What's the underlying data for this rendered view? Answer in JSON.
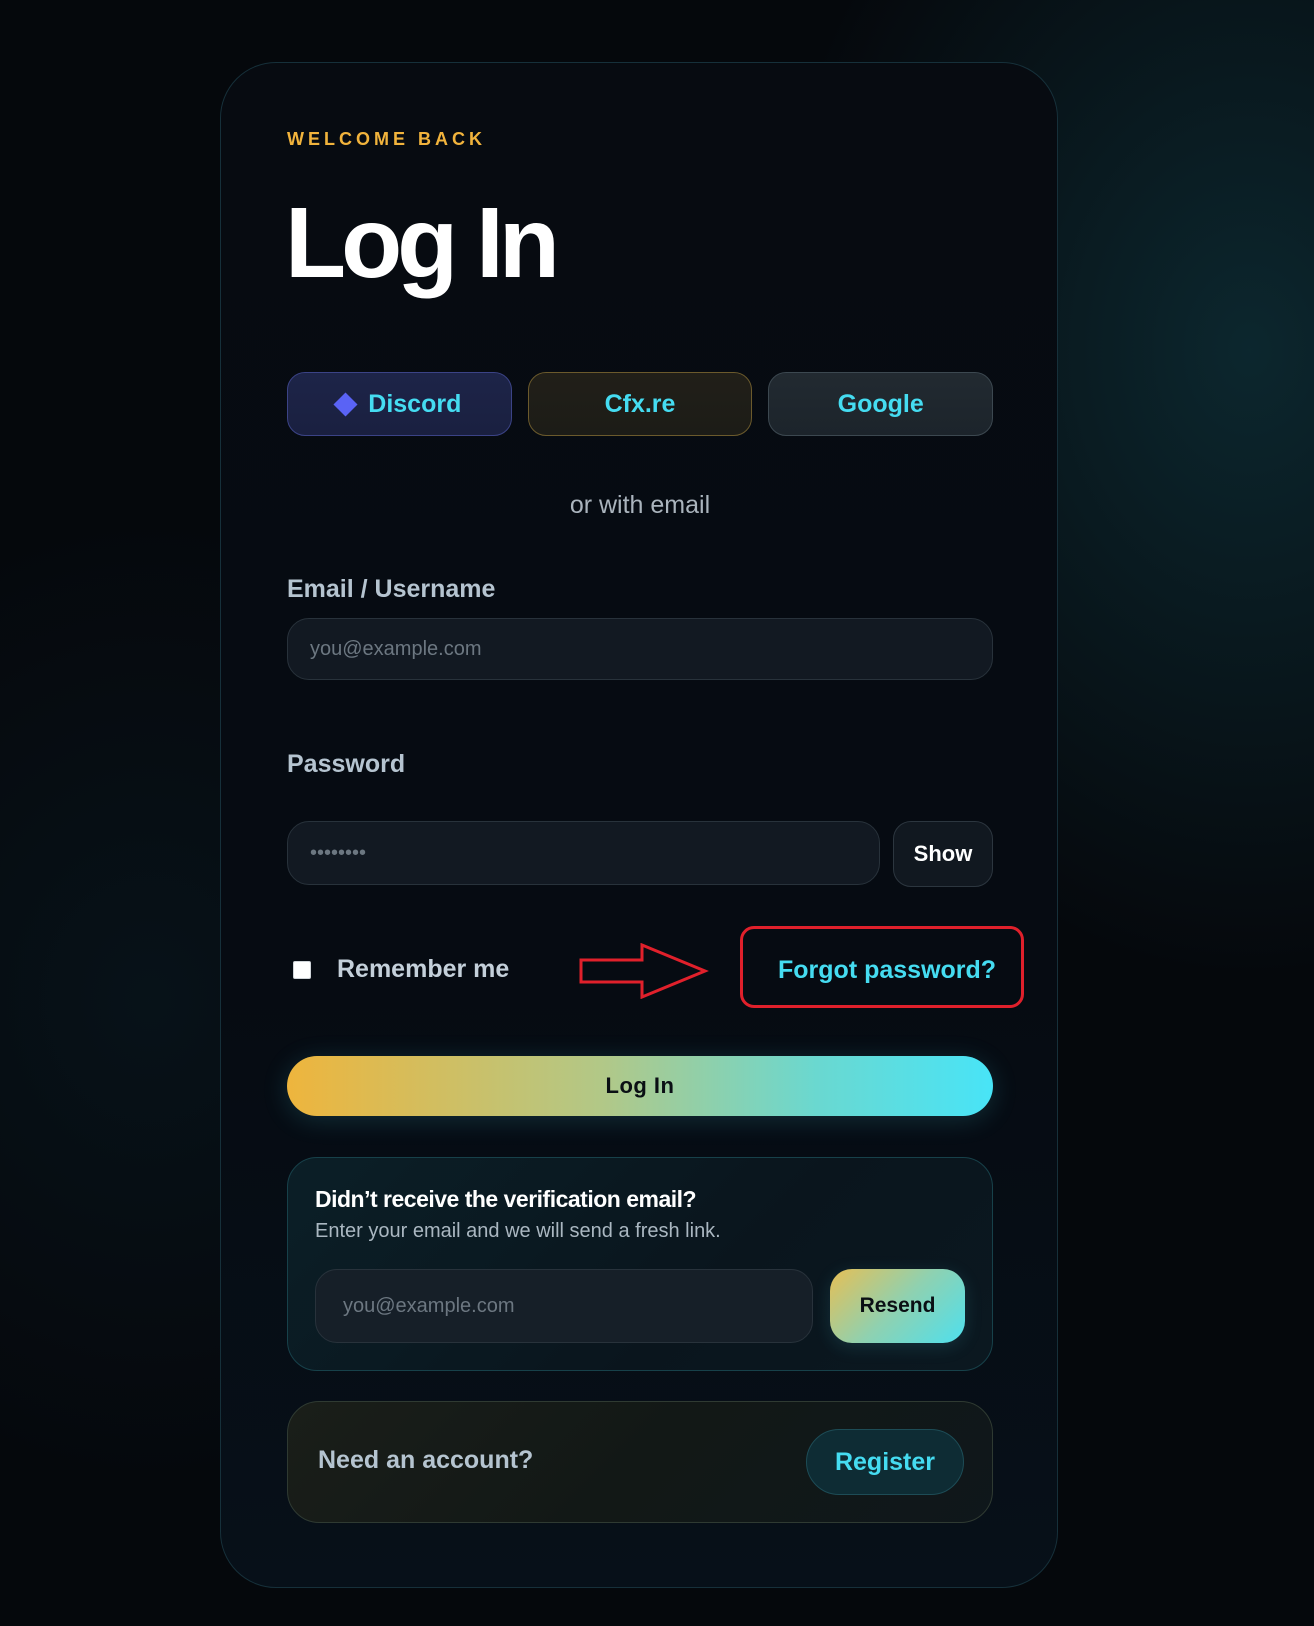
{
  "header": {
    "eyebrow": "WELCOME BACK",
    "title": "Log In"
  },
  "social": {
    "discord_label": "Discord",
    "discord_icon": "diamond-icon",
    "cfx_label": "Cfx.re",
    "google_label": "Google"
  },
  "divider_text": "or with email",
  "email": {
    "label": "Email / Username",
    "placeholder": "you@example.com",
    "value": ""
  },
  "password": {
    "label": "Password",
    "placeholder": "••••••••",
    "show_label": "Show"
  },
  "options": {
    "remember_label": "Remember me",
    "remember_checked": false,
    "forgot_label": "Forgot password?"
  },
  "annotation": {
    "arrow_color": "#e0202b",
    "highlight_color": "#e0202b"
  },
  "login_button_label": "Log In",
  "verification": {
    "title": "Didn’t receive the verification email?",
    "subtitle": "Enter your email and we will send a fresh link.",
    "placeholder": "you@example.com",
    "resend_label": "Resend"
  },
  "account": {
    "prompt": "Need an account?",
    "register_label": "Register"
  },
  "colors": {
    "accent_gold": "#f1b33c",
    "accent_cyan": "#45dcf1",
    "background": "#05080c"
  }
}
